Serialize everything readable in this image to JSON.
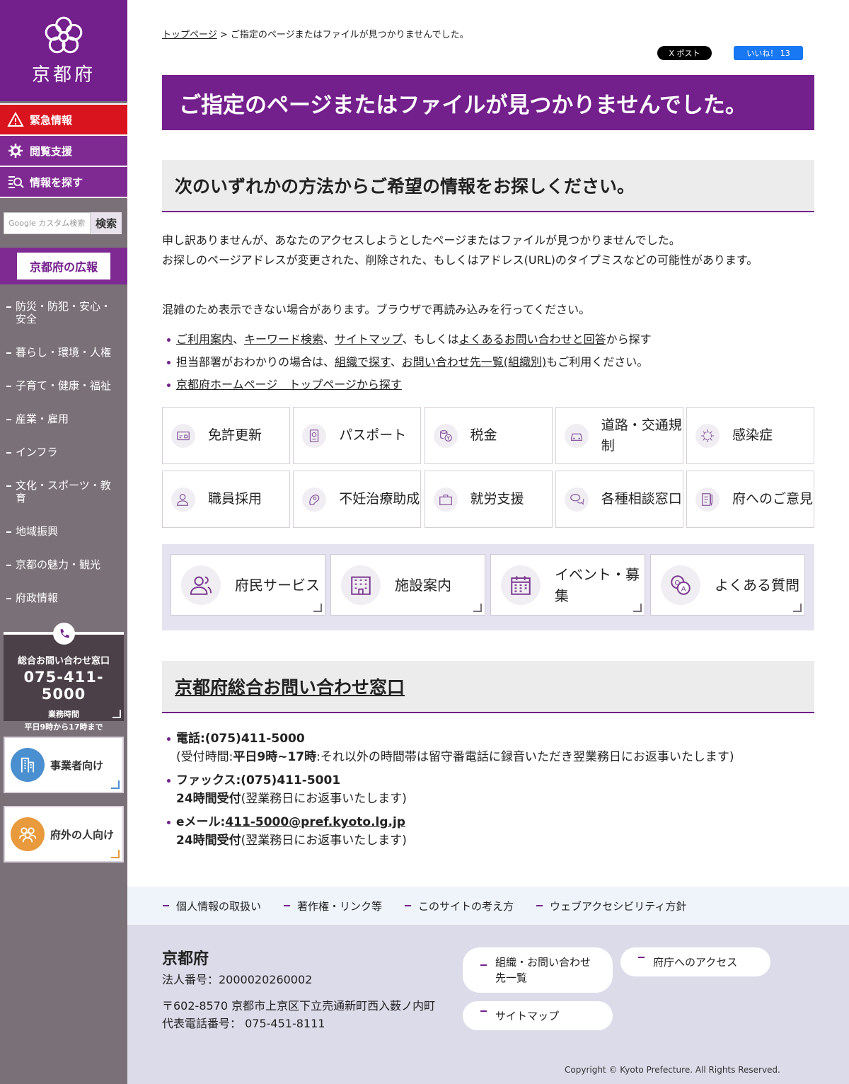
{
  "sidebar": {
    "logo_text": "京都府",
    "emergency": "緊急情報",
    "accessibility": "閲覧支援",
    "find_info": "情報を探す",
    "search_placeholder": "Google カスタム検索",
    "search_button": "検索",
    "koho": "京都府の広報",
    "nav": [
      "防災・防犯・安心・安全",
      "暮らし・環境・人権",
      "子育て・健康・福祉",
      "産業・雇用",
      "インフラ",
      "文化・スポーツ・教育",
      "地域振興",
      "京都の魅力・観光",
      "府政情報"
    ],
    "inquiry": {
      "title": "総合お問い合わせ窓口",
      "phone": "075-411-5000",
      "hours_label": "業務時間",
      "hours": "平日9時から17時まで"
    },
    "business": "事業者向け",
    "outside": "府外の人向け"
  },
  "breadcrumb": {
    "home": "トップページ",
    "sep": " > ",
    "current": "ご指定のページまたはファイルが見つかりませんでした。"
  },
  "social": {
    "x": "X ポスト",
    "fb": "いいね！ 13"
  },
  "title": "ご指定のページまたはファイルが見つかりませんでした。",
  "section1": {
    "heading": "次のいずれかの方法からご希望の情報をお探しください。",
    "p1": "申し訳ありませんが、あなたのアクセスしようとしたページまたはファイルが見つかりませんでした。",
    "p2": "お探しのページアドレスが変更された、削除された、もしくはアドレス(URL)のタイプミスなどの可能性があります。",
    "p3": "混雑のため表示できない場合があります。ブラウザで再読み込みを行ってください。",
    "b1": {
      "l1": "ご利用案内",
      "s1": "、",
      "l2": "キーワード検索",
      "s2": "、",
      "l3": "サイトマップ",
      "s3": "、もしくは",
      "l4": "よくあるお問い合わせと回答",
      "s4": "から探す"
    },
    "b2": {
      "pre": "担当部署がおわかりの場合は、",
      "l1": "組織で探す",
      "s1": "、",
      "l2": "お問い合わせ先一覧(組織別)",
      "s2": "もご利用ください。"
    },
    "b3": {
      "l1": "京都府ホームページ　トップページから探す"
    }
  },
  "tiles": [
    {
      "label": "免許更新",
      "icon": "license-card-icon"
    },
    {
      "label": "パスポート",
      "icon": "passport-icon"
    },
    {
      "label": "税金",
      "icon": "coins-icon"
    },
    {
      "label": "道路・交通規制",
      "icon": "car-icon"
    },
    {
      "label": "感染症",
      "icon": "virus-icon"
    },
    {
      "label": "職員採用",
      "icon": "staff-icon"
    },
    {
      "label": "不妊治療助成",
      "icon": "fertility-icon"
    },
    {
      "label": "就労支援",
      "icon": "briefcase-icon"
    },
    {
      "label": "各種相談窓口",
      "icon": "chat-icon"
    },
    {
      "label": "府へのご意見",
      "icon": "opinion-icon"
    }
  ],
  "features": [
    {
      "label": "府民サービス",
      "icon": "people-icon"
    },
    {
      "label": "施設案内",
      "icon": "building-icon"
    },
    {
      "label": "イベント・募集",
      "icon": "calendar-icon"
    },
    {
      "label": "よくある質問",
      "icon": "qa-icon"
    }
  ],
  "section2": {
    "heading": "京都府総合お問い合わせ窓口",
    "tel": "電話:(075)411-5000",
    "tel_note_pre": "(受付時間:",
    "tel_note_bold": "平日9時~17時",
    "tel_note_post": ":それ以外の時間帯は留守番電話に録音いただき翌業務日にお返事いたします)",
    "fax": "ファックス:(075)411-5001",
    "fax_note_bold": "24時間受付",
    "fax_note_post": "(翌業務日にお返事いたします)",
    "mail_label": "eメール:",
    "mail": "411-5000@pref.kyoto.lg.jp",
    "mail_note_bold": "24時間受付",
    "mail_note_post": "(翌業務日にお返事いたします)"
  },
  "footer_links": [
    "個人情報の取扱い",
    "著作権・リンク等",
    "このサイトの考え方",
    "ウェブアクセシビリティ方針"
  ],
  "footer": {
    "org": "京都府",
    "corp_no": "法人番号：2000020260002",
    "address": "〒602-8570 京都市上京区下立売通新町西入薮ノ内町",
    "tel": "代表電話番号： 075-451-8111",
    "pill1": "組織・お問い合わせ先一覧",
    "pill2": "府庁へのアクセス",
    "pill3": "サイトマップ",
    "copyright": "Copyright © Kyoto Prefecture. All Rights Reserved."
  },
  "colors": {
    "brand": "#731f8c",
    "emergency": "#d9141e",
    "sidebar": "#7a7077"
  }
}
